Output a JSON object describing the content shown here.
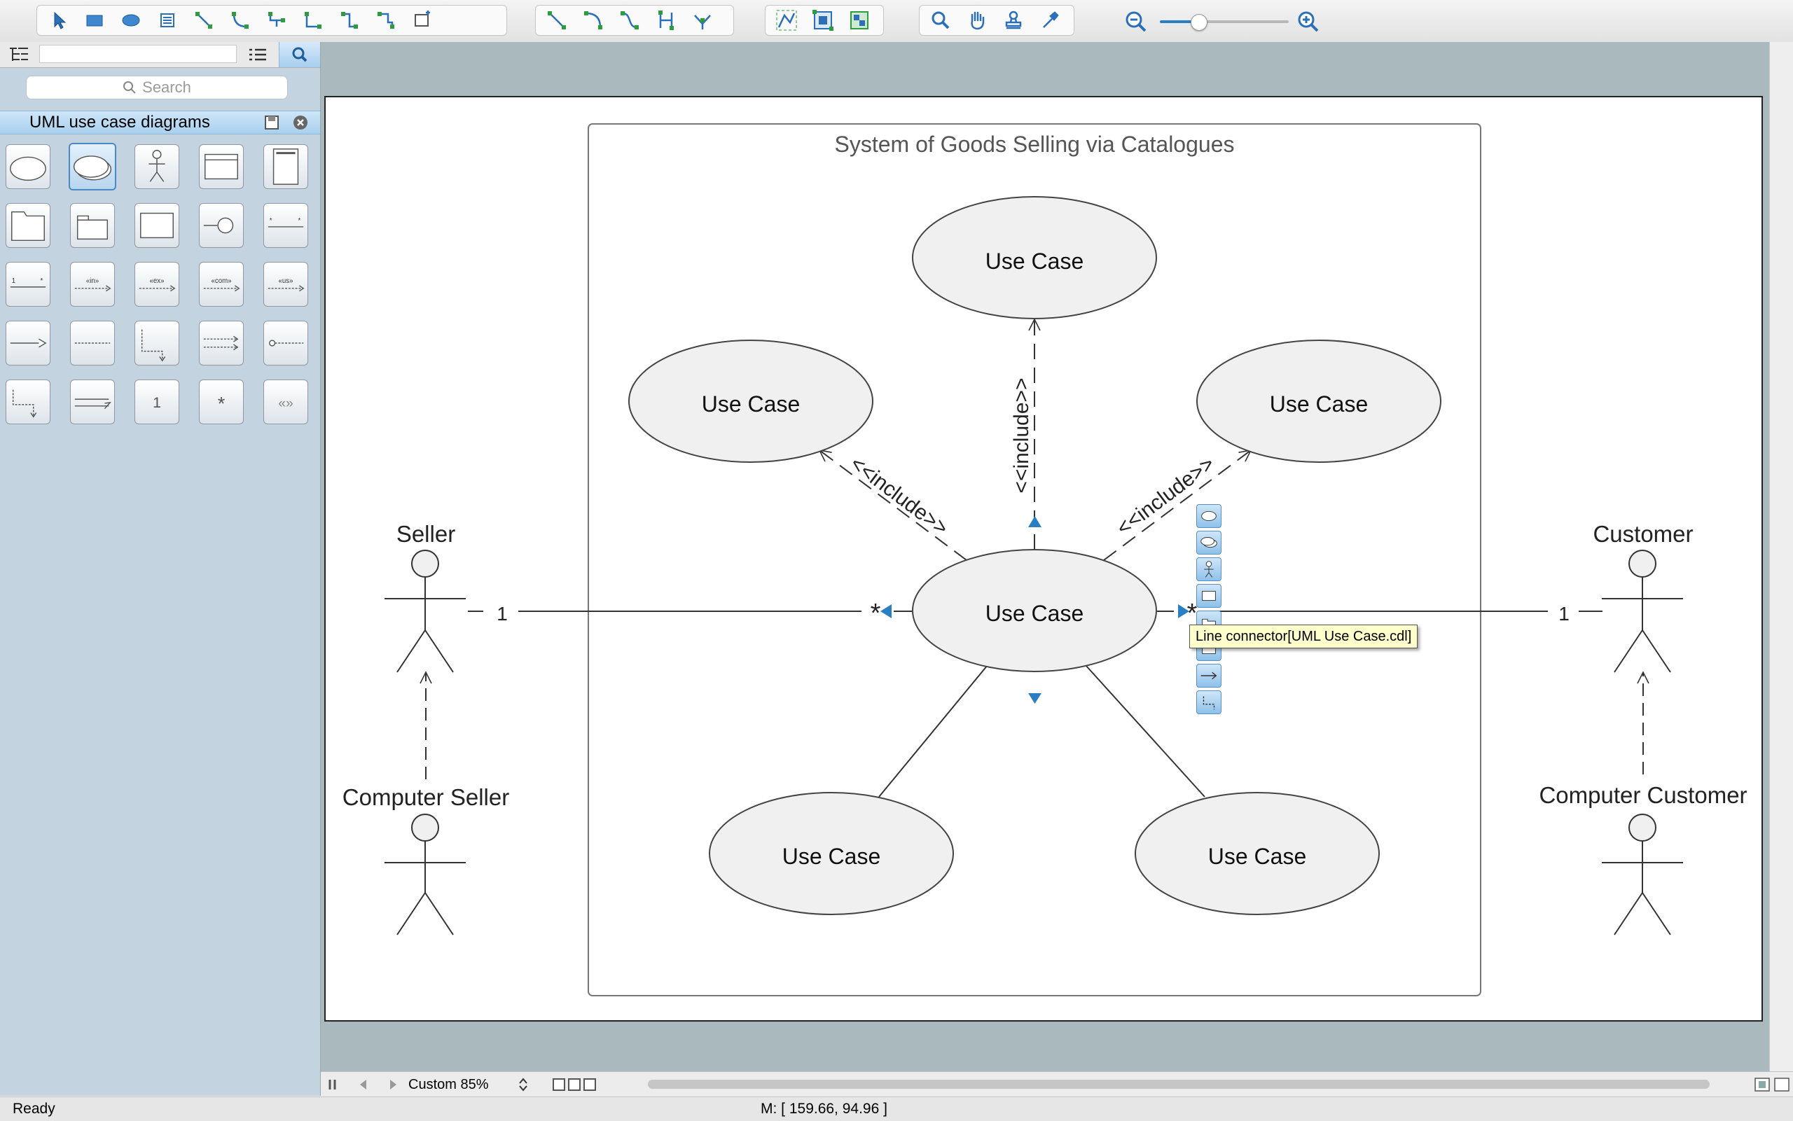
{
  "toolbar": {
    "groups": [
      [
        "pointer-icon",
        "rectangle-icon",
        "ellipse-icon",
        "text-block-icon",
        "connector-icon",
        "curved-connector-icon",
        "tree-connector-icon",
        "orthogonal-connector-icon",
        "round-connector-icon",
        "smart-connector-icon",
        "insert-icon"
      ],
      [
        "line-icon",
        "arc-icon",
        "bezier-icon",
        "spline-icon",
        "polyline-icon"
      ],
      [
        "snap-icon",
        "fit-icon",
        "group-icon"
      ],
      [
        "zoom-icon",
        "hand-pan-icon",
        "stamp-icon",
        "eyedropper-icon"
      ]
    ],
    "zoom_slider_level": 0.3
  },
  "library": {
    "search_placeholder": "Search",
    "title": "UML use case diagrams",
    "shape_labels": [
      "«in»",
      "«ex»",
      "«com»",
      "«us»",
      "1",
      "*",
      "«»"
    ]
  },
  "diagram": {
    "system_title": "System of Goods Selling via Catalogues",
    "use_case_label": "Use Case",
    "include_label": "<<include>>",
    "actors": {
      "seller": "Seller",
      "computer_seller": "Computer Seller",
      "customer": "Customer",
      "computer_customer": "Computer Customer"
    },
    "multiplicity_one": "1",
    "multiplicity_many": "*",
    "tooltip": "Line connector[UML Use Case.cdl]"
  },
  "footer": {
    "zoom_label": "Custom 85%",
    "status": "Ready",
    "mouse_position": "M: [ 159.66, 94.96 ]"
  },
  "colors": {
    "canvas_bg": "#a9b9bd",
    "panel_bg": "#c4d3e0",
    "use_case_fill": "#f0f0f0",
    "accent": "#2a7fc3"
  }
}
